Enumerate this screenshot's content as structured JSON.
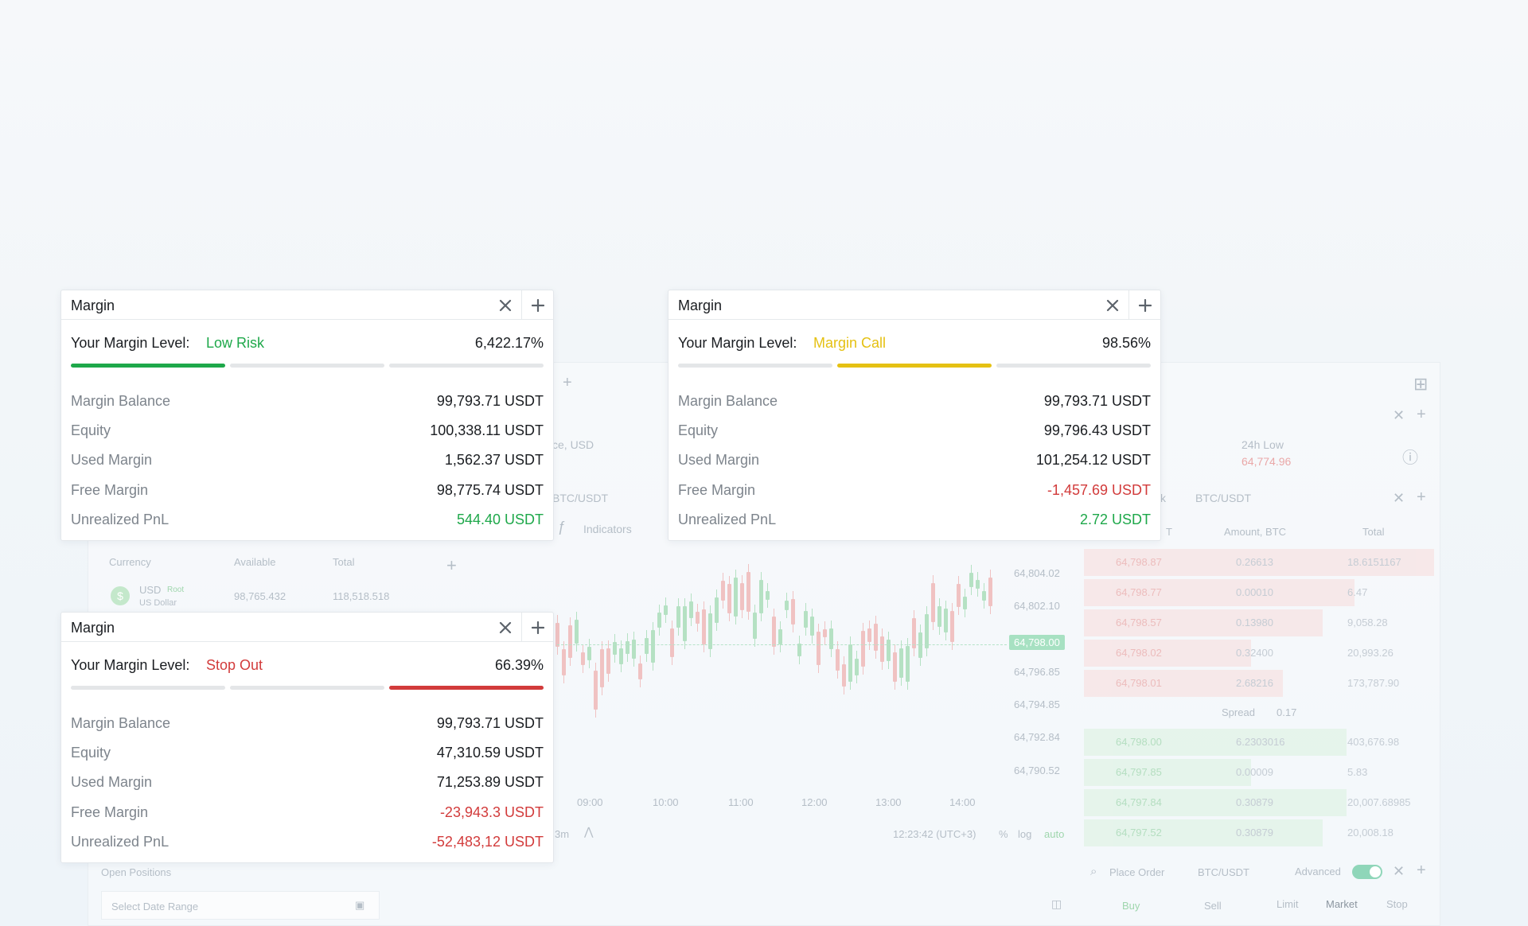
{
  "background": {
    "partial_currency": "ce, USD",
    "pair_label_left": "BTC/USDT",
    "pair_label_right": "BTC/USDT",
    "pair_partial_prefix": "k",
    "indicators": "Indicators",
    "low_label": "24h Low",
    "low_value": "64,774.96",
    "balances_headers": [
      "Currency",
      "Available",
      "Total"
    ],
    "balance_row": {
      "currency": "USD",
      "badge": "Root",
      "sub": "US Dollar",
      "available": "98,765.432",
      "total": "118,518.518"
    },
    "price_axis": [
      "64,804.02",
      "64,802.10",
      "64,796.85",
      "64,794.85",
      "64,792.84",
      "64,790.52"
    ],
    "current_price": "64,798.00",
    "time_axis": [
      "09:00",
      "10:00",
      "11:00",
      "12:00",
      "13:00",
      "14:00"
    ],
    "chart_footer": {
      "interval": "3m",
      "time": "12:23:42 (UTC+3)",
      "pct": "%",
      "log": "log",
      "auto": "auto"
    },
    "orderbook_headers": [
      "T",
      "Amount, BTC",
      "Total"
    ],
    "asks": [
      {
        "price": "64,798.87",
        "amount": "0.26613",
        "total": "18.6151167"
      },
      {
        "price": "64,798.77",
        "amount": "0.00010",
        "total": "6.47"
      },
      {
        "price": "64,798.57",
        "amount": "0.13980",
        "total": "9,058.28"
      },
      {
        "price": "64,798.02",
        "amount": "0.32400",
        "total": "20,993.26"
      },
      {
        "price": "64,798.01",
        "amount": "2.68216",
        "total": "173,787.90"
      }
    ],
    "spread_label": "Spread",
    "spread_value": "0.17",
    "bids": [
      {
        "price": "64,798.00",
        "amount": "6.2303016",
        "total": "403,676.98"
      },
      {
        "price": "64,797.85",
        "amount": "0.00009",
        "total": "5.83"
      },
      {
        "price": "64,797.84",
        "amount": "0.30879",
        "total": "20,007.68985"
      },
      {
        "price": "64,797.52",
        "amount": "0.30879",
        "total": "20,008.18"
      }
    ],
    "open_positions": "Open Positions",
    "date_range_placeholder": "Select Date Range",
    "place_order": "Place Order",
    "place_order_pair": "BTC/USDT",
    "advanced": "Advanced",
    "order_sides": [
      "Buy",
      "Sell"
    ],
    "order_types": [
      "Limit",
      "Market",
      "Stop"
    ]
  },
  "cards": [
    {
      "title": "Margin",
      "level_label": "Your Margin Level:",
      "status": "Low Risk",
      "status_color": "#1ea84a",
      "level_value": "6,422.17%",
      "active_bar": 0,
      "rows": [
        {
          "label": "Margin Balance",
          "value": "99,793.71 USDT",
          "tone": ""
        },
        {
          "label": "Equity",
          "value": "100,338.11 USDT",
          "tone": ""
        },
        {
          "label": "Used Margin",
          "value": "1,562.37 USDT",
          "tone": ""
        },
        {
          "label": "Free Margin",
          "value": "98,775.74 USDT",
          "tone": ""
        },
        {
          "label": "Unrealized PnL",
          "value": "544.40 USDT",
          "tone": "green"
        }
      ]
    },
    {
      "title": "Margin",
      "level_label": "Your Margin Level:",
      "status": "Margin Call",
      "status_color": "#e5c113",
      "level_value": "98.56%",
      "active_bar": 1,
      "rows": [
        {
          "label": "Margin Balance",
          "value": "99,793.71 USDT",
          "tone": ""
        },
        {
          "label": "Equity",
          "value": "99,796.43 USDT",
          "tone": ""
        },
        {
          "label": "Used Margin",
          "value": "101,254.12 USDT",
          "tone": ""
        },
        {
          "label": "Free Margin",
          "value": "-1,457.69 USDT",
          "tone": "red"
        },
        {
          "label": "Unrealized PnL",
          "value": "2.72 USDT",
          "tone": "green"
        }
      ]
    },
    {
      "title": "Margin",
      "level_label": "Your Margin Level:",
      "status": "Stop Out",
      "status_color": "#d23b3b",
      "level_value": "66.39%",
      "active_bar": 2,
      "rows": [
        {
          "label": "Margin Balance",
          "value": "99,793.71 USDT",
          "tone": ""
        },
        {
          "label": "Equity",
          "value": "47,310.59 USDT",
          "tone": ""
        },
        {
          "label": "Used Margin",
          "value": "71,253.89 USDT",
          "tone": ""
        },
        {
          "label": "Free Margin",
          "value": "-23,943.3 USDT",
          "tone": "red"
        },
        {
          "label": "Unrealized PnL",
          "value": "-52,483,12 USDT",
          "tone": "red"
        }
      ]
    }
  ]
}
